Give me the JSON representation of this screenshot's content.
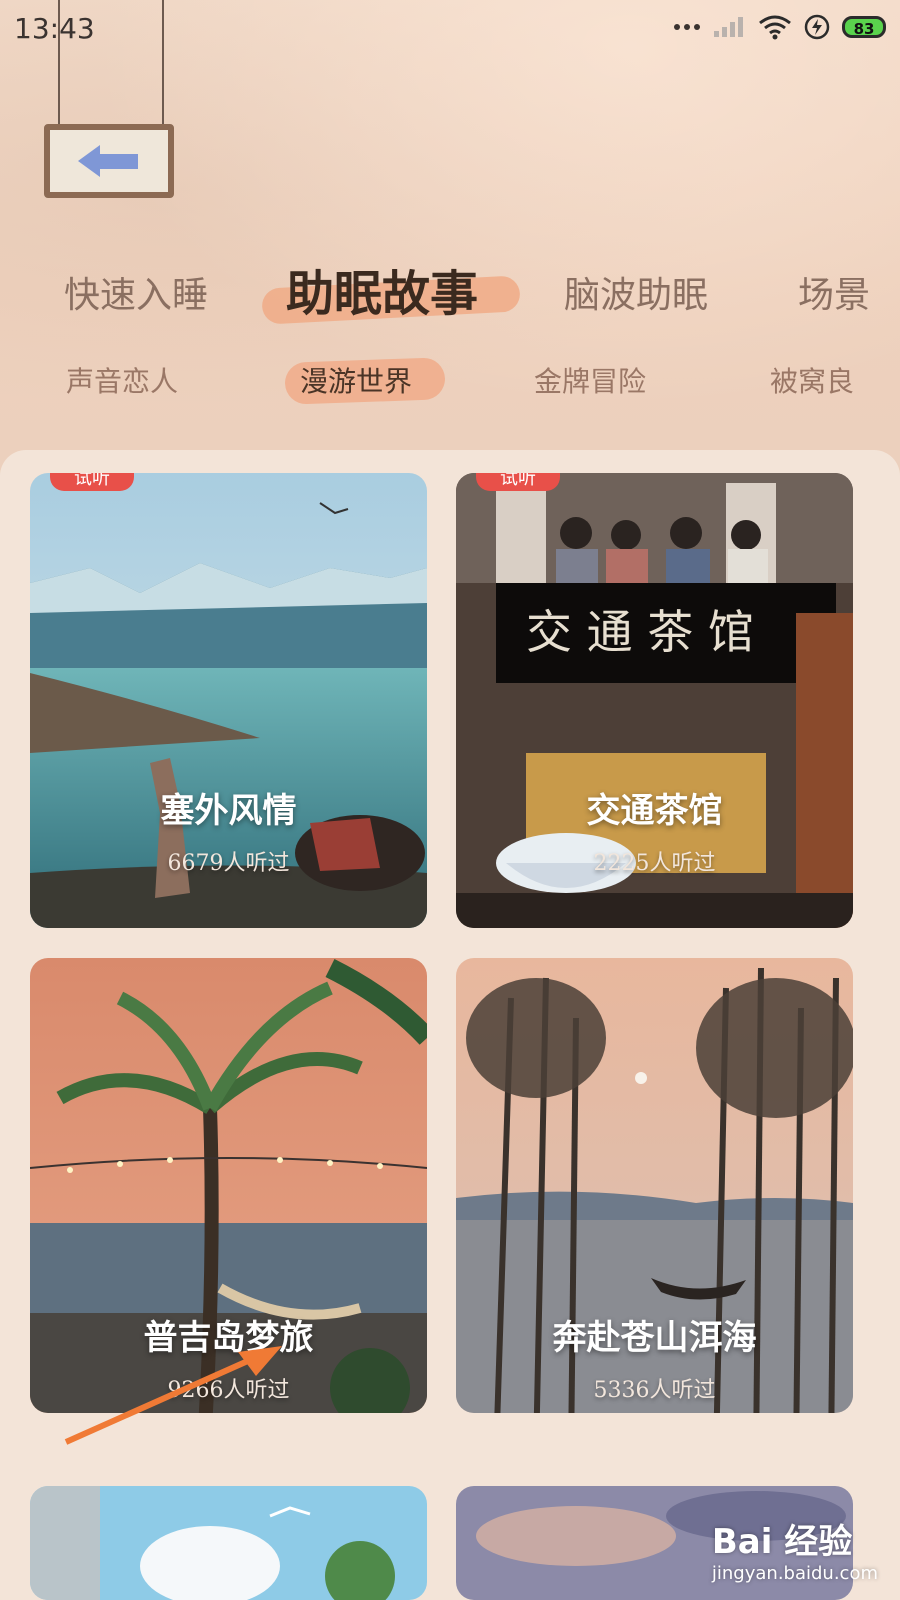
{
  "status_bar": {
    "time": "13:43",
    "battery": "83",
    "icons": [
      "more-dots-icon",
      "signal-icon",
      "wifi-icon",
      "charging-icon",
      "battery-icon"
    ]
  },
  "back_button": {
    "icon": "left-arrow-icon"
  },
  "main_tabs": [
    {
      "label": "快速入睡",
      "active": false
    },
    {
      "label": "助眠故事",
      "active": true
    },
    {
      "label": "脑波助眠",
      "active": false
    },
    {
      "label": "场景",
      "active": false
    }
  ],
  "sub_tabs": [
    {
      "label": "声音恋人",
      "active": false
    },
    {
      "label": "漫游世界",
      "active": true
    },
    {
      "label": "金牌冒险",
      "active": false
    },
    {
      "label": "被窝良",
      "active": false
    }
  ],
  "cards": [
    {
      "title": "塞外风情",
      "listens": "6679人听过",
      "badge": "试听"
    },
    {
      "title": "交通茶馆",
      "listens": "2225人听过",
      "badge": "试听"
    },
    {
      "title": "普吉岛梦旅",
      "listens": "9266人听过"
    },
    {
      "title": "奔赴苍山洱海",
      "listens": "5336人听过"
    }
  ],
  "watermark": {
    "logo": "Bai 经验",
    "url": "jingyan.baidu.com"
  },
  "colors": {
    "accent_brush": "#f0ad8a",
    "badge": "#e85049",
    "arrow": "#f07a35"
  }
}
